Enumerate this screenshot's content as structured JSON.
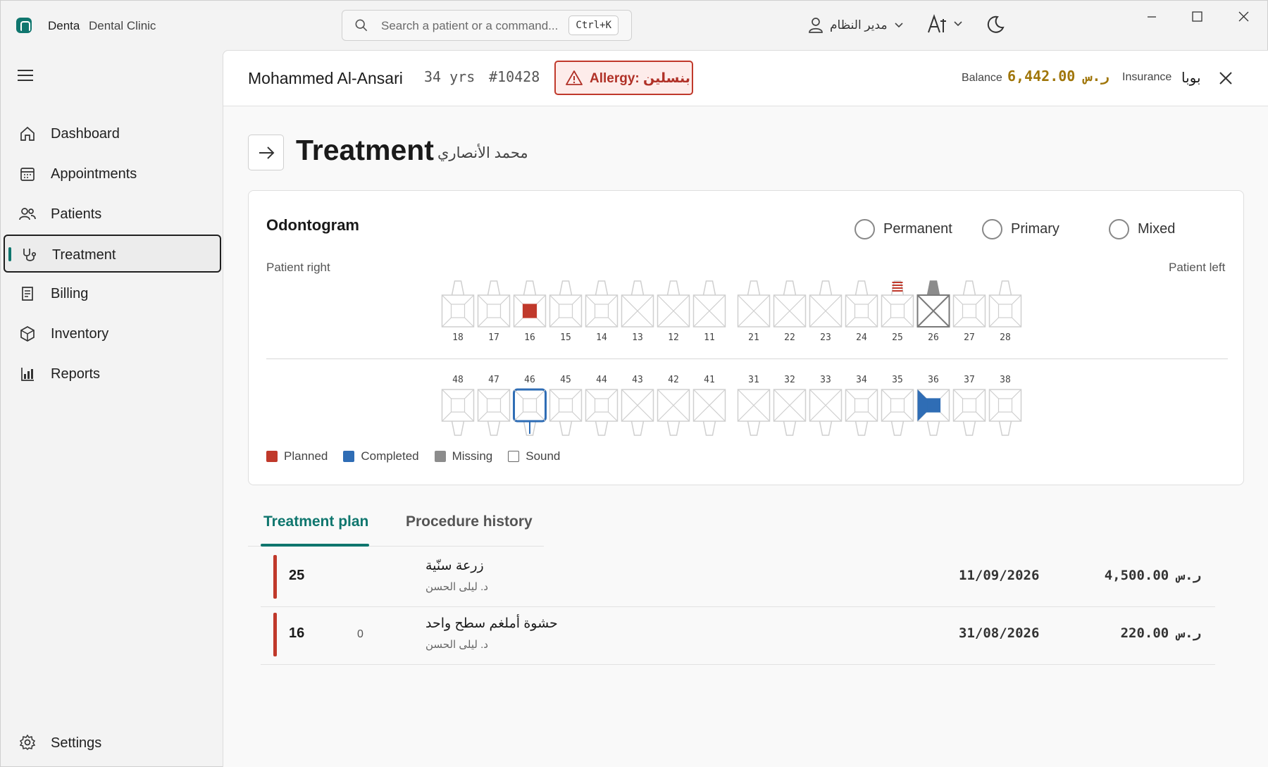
{
  "app": {
    "name": "Denta",
    "subtitle": "Dental Clinic"
  },
  "search": {
    "placeholder": "Search a patient or a command...",
    "shortcut": "Ctrl+K"
  },
  "user": {
    "label": "مدير النظام"
  },
  "sidebar": {
    "items": [
      {
        "label": "Dashboard",
        "icon": "home-icon"
      },
      {
        "label": "Appointments",
        "icon": "calendar-icon"
      },
      {
        "label": "Patients",
        "icon": "people-icon"
      },
      {
        "label": "Treatment",
        "icon": "stethoscope-icon",
        "active": true
      },
      {
        "label": "Billing",
        "icon": "receipt-icon"
      },
      {
        "label": "Inventory",
        "icon": "box-icon"
      },
      {
        "label": "Reports",
        "icon": "chart-icon"
      }
    ],
    "settings_label": "Settings"
  },
  "patient": {
    "name": "Mohammed Al-Ansari",
    "age": "34 yrs",
    "id": "#10428",
    "allergy": "Allergy: بنسلين",
    "balance_label": "Balance",
    "balance_value": "6,442.00 ر.س",
    "insurance_label": "Insurance",
    "insurance_value": "بوبا"
  },
  "page": {
    "title": "Treatment",
    "subtitle": "محمد الأنصاري"
  },
  "odontogram": {
    "title": "Odontogram",
    "dentition_options": [
      "Permanent",
      "Primary",
      "Mixed"
    ],
    "patient_right": "Patient right",
    "patient_left": "Patient left",
    "upper": [
      "18",
      "17",
      "16",
      "15",
      "14",
      "13",
      "12",
      "11",
      "21",
      "22",
      "23",
      "24",
      "25",
      "26",
      "27",
      "28"
    ],
    "lower": [
      "48",
      "47",
      "46",
      "45",
      "44",
      "43",
      "42",
      "41",
      "31",
      "32",
      "33",
      "34",
      "35",
      "36",
      "37",
      "38"
    ],
    "legend": [
      {
        "label": "Planned",
        "color": "#c0392b"
      },
      {
        "label": "Completed",
        "color": "#2f6db5"
      },
      {
        "label": "Missing",
        "color": "#8c8c8c"
      },
      {
        "label": "Sound",
        "color": "#ffffff"
      }
    ]
  },
  "tabs": {
    "plan": "Treatment plan",
    "history": "Procedure history"
  },
  "plan_rows": [
    {
      "tooth": "25",
      "count": "",
      "procedure": "زرعة سنّية",
      "doctor": "د. ليلى الحسن",
      "date": "11/09/2026",
      "amount": "4,500.00 ر.س"
    },
    {
      "tooth": "16",
      "count": "0",
      "procedure": "حشوة أملغم سطح واحد",
      "doctor": "د. ليلى الحسن",
      "date": "31/08/2026",
      "amount": "220.00 ر.س"
    }
  ]
}
